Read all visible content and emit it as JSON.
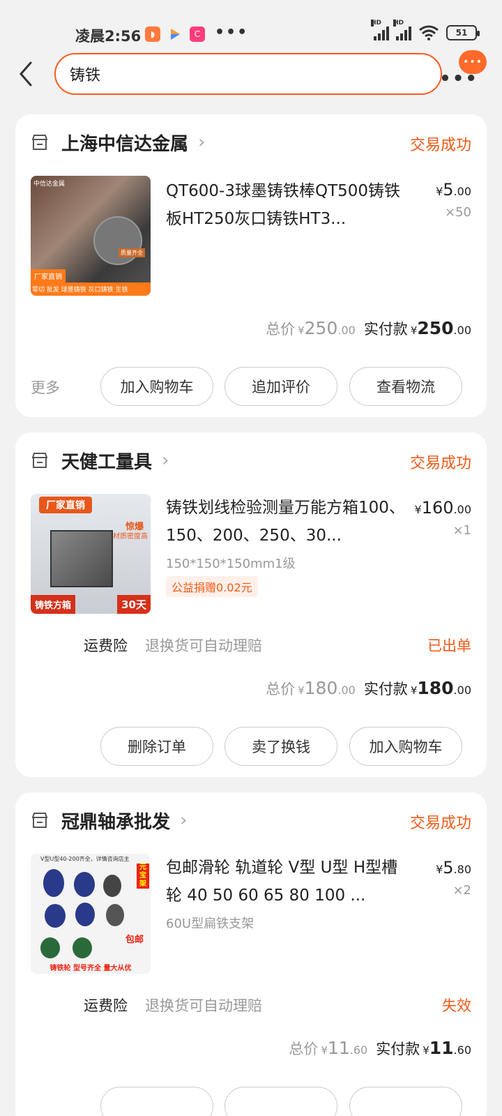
{
  "status_bar": {
    "time": "凌晨2:56",
    "dots": "•••",
    "battery": "51",
    "signal1_hd": "HD",
    "signal2_hd": "HD"
  },
  "search": {
    "query": "铸铁",
    "bubble": "•••",
    "menu": "•••"
  },
  "orders": [
    {
      "shop": "上海中信达金属",
      "status": "交易成功",
      "title": "QT600-3球墨铸铁棒QT500铸铁板HT250灰口铸铁HT3...",
      "price_int": "5",
      "price_dec": ".00",
      "qty": "×50",
      "total_label": "总价",
      "total_int": "250",
      "total_dec": ".00",
      "paid_label": "实付款",
      "paid_int": "250",
      "paid_dec": ".00",
      "more": "更多",
      "buttons": [
        "加入购物车",
        "追加评价",
        "查看物流"
      ],
      "thumb_text": [
        "中信达金属",
        "质量齐全",
        "厂家直销",
        "零切 批发 球墨铸铁 灰口铸铁 生铁"
      ]
    },
    {
      "shop": "天健工量具",
      "status": "交易成功",
      "title": "铸铁划线检验测量万能方箱100、150、200、250、30...",
      "price_int": "160",
      "price_dec": ".00",
      "qty": "×1",
      "sku": "150*150*150mm1级",
      "charity": "公益捐赠0.02元",
      "insure_label": "运费险",
      "insure_desc": "退换货可自动理赔",
      "insure_status": "已出单",
      "total_label": "总价",
      "total_int": "180",
      "total_dec": ".00",
      "paid_label": "实付款",
      "paid_int": "180",
      "paid_dec": ".00",
      "buttons": [
        "删除订单",
        "卖了换钱",
        "加入购物车"
      ],
      "thumb_text": [
        "厂家直销",
        "惊爆",
        "材质密度高",
        "铸铁方箱",
        "30天"
      ]
    },
    {
      "shop": "冠鼎轴承批发",
      "status": "交易成功",
      "title": "包邮滑轮 轨道轮 V型 U型 H型槽轮 40 50 60 65 80 100 ...",
      "price_int": "5",
      "price_dec": ".80",
      "qty": "×2",
      "sku": "60U型扁铁支架",
      "insure_label": "运费险",
      "insure_desc": "退换货可自动理赔",
      "insure_status": "失效",
      "total_label": "总价",
      "total_int": "11",
      "total_dec": ".60",
      "paid_label": "实付款",
      "paid_int": "11",
      "paid_dec": ".60",
      "thumb_text": [
        "V型U型40-200齐全，详情咨询店主",
        "元宝架",
        "包邮",
        "铸铁轮 型号齐全 量大从优"
      ]
    }
  ],
  "currency": "¥",
  "colors": {
    "accent": "#f05a16",
    "search_border": "#ff5a1f",
    "bg": "#f2f2f2"
  }
}
